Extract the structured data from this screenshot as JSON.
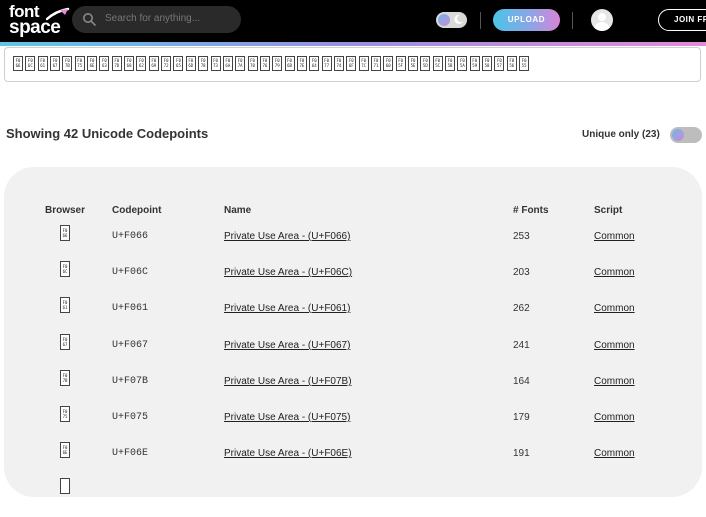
{
  "header": {
    "logo_line1": "font",
    "logo_line2": "space",
    "search_placeholder": "Search for anything...",
    "upload_label": "UPLOAD",
    "join_label": "JOIN FREE"
  },
  "colors": {
    "header_bg": "#000000",
    "accent_gradient": [
      "#4cc3e8",
      "#d884d9"
    ],
    "panel_bg": "#f1f1f1"
  },
  "icons": {
    "logo": "rocket-swoosh-icon",
    "search": "search-icon",
    "theme": "moon-icon",
    "avatar": "user-avatar-icon"
  },
  "strip": {
    "glyph_codes": [
      "F0 66",
      "F0 6C",
      "F0 61",
      "F0 67",
      "F0 7B",
      "F0 75",
      "F0 6E",
      "F0 63",
      "F0 7D",
      "F0 68",
      "F0 62",
      "F0 69",
      "F0 72",
      "F0 65",
      "F0 6D",
      "F0 78",
      "F0 73",
      "F0 6A",
      "F0 7A",
      "F0 70",
      "F0 76",
      "F0 79",
      "F0 6B",
      "F0 7E",
      "F0 64",
      "F0 77",
      "F0 74",
      "F0 6F",
      "F0 7C",
      "F0 71",
      "F0 60",
      "F0 5F",
      "F0 5E",
      "F0 5D",
      "F0 5C",
      "F0 5B",
      "F0 5A",
      "F0 59",
      "F0 58",
      "F0 57",
      "F0 56",
      "F0 55"
    ]
  },
  "summary": {
    "showing": "Showing 42 Unicode Codepoints",
    "unique_label": "Unique only (23)"
  },
  "table": {
    "headers": [
      "Browser",
      "Codepoint",
      "Name",
      "# Fonts",
      "Script"
    ],
    "rows": [
      {
        "glyph": "F0 66",
        "codepoint": "U+F066",
        "name": "Private Use Area - (U+F066)",
        "fonts": "253",
        "script": "Common"
      },
      {
        "glyph": "F0 6C",
        "codepoint": "U+F06C",
        "name": "Private Use Area - (U+F06C)",
        "fonts": "203",
        "script": "Common"
      },
      {
        "glyph": "F0 61",
        "codepoint": "U+F061",
        "name": "Private Use Area - (U+F061)",
        "fonts": "262",
        "script": "Common"
      },
      {
        "glyph": "F0 67",
        "codepoint": "U+F067",
        "name": "Private Use Area - (U+F067)",
        "fonts": "241",
        "script": "Common"
      },
      {
        "glyph": "F0 7B",
        "codepoint": "U+F07B",
        "name": "Private Use Area - (U+F07B)",
        "fonts": "164",
        "script": "Common"
      },
      {
        "glyph": "F0 75",
        "codepoint": "U+F075",
        "name": "Private Use Area - (U+F075)",
        "fonts": "179",
        "script": "Common"
      },
      {
        "glyph": "F0 6E",
        "codepoint": "U+F06E",
        "name": "Private Use Area - (U+F06E)",
        "fonts": "191",
        "script": "Common"
      }
    ]
  }
}
